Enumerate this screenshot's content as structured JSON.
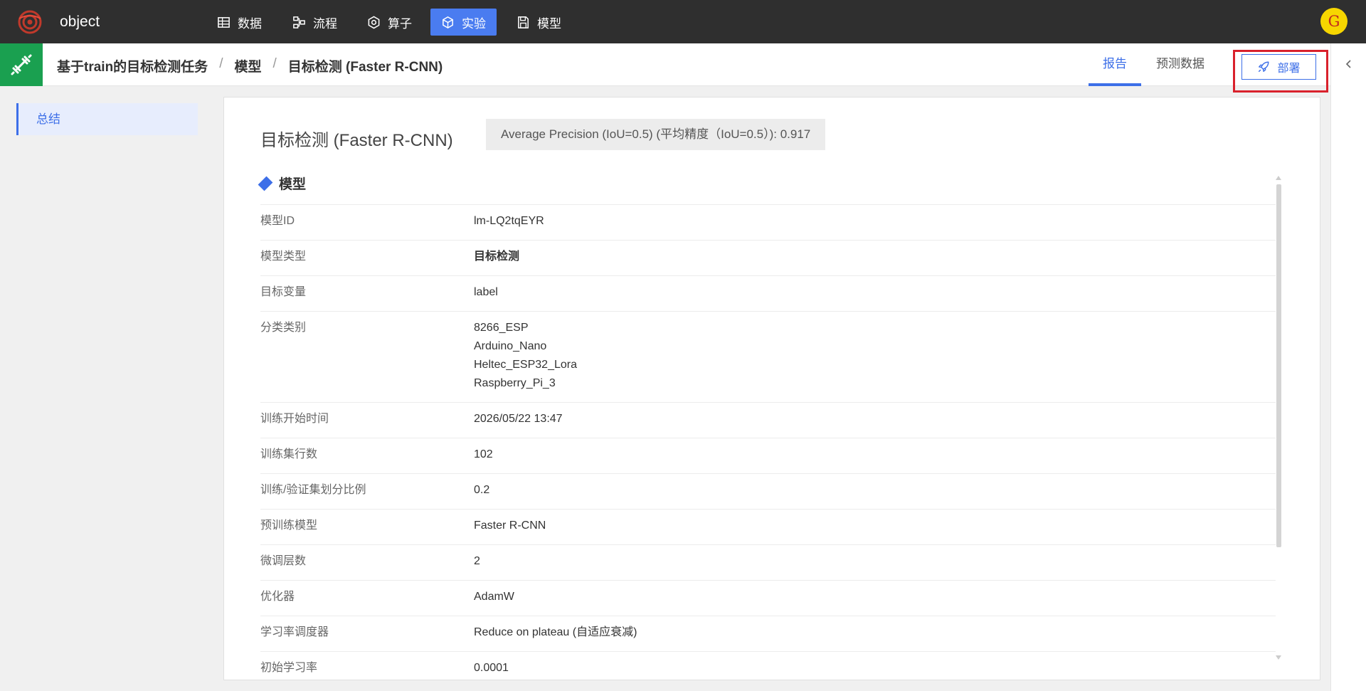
{
  "app": {
    "name": "object",
    "avatar_letter": "G"
  },
  "nav": [
    {
      "label": "数据",
      "icon": "table-icon",
      "active": false
    },
    {
      "label": "流程",
      "icon": "flow-icon",
      "active": false
    },
    {
      "label": "算子",
      "icon": "hexagon-icon",
      "active": false
    },
    {
      "label": "实验",
      "icon": "cube-icon",
      "active": true
    },
    {
      "label": "模型",
      "icon": "save-icon",
      "active": false
    }
  ],
  "breadcrumb": [
    "基于train的目标检测任务",
    "模型",
    "目标检测 (Faster R-CNN)"
  ],
  "breadcrumb_sep": "/",
  "tabs": {
    "report": "报告",
    "prediction": "预测数据"
  },
  "deploy_label": "部署",
  "sidebar": {
    "summary": "总结"
  },
  "card": {
    "title": "目标检测 (Faster R-CNN)",
    "metric": "Average Precision (IoU=0.5) (平均精度（IoU=0.5）): 0.917",
    "section": "模型"
  },
  "rows": [
    {
      "label": "模型ID",
      "value": "lm-LQ2tqEYR"
    },
    {
      "label": "模型类型",
      "value": "目标检测"
    },
    {
      "label": "目标变量",
      "value": "label"
    },
    {
      "label": "分类类别",
      "values": [
        "8266_ESP",
        "Arduino_Nano",
        "Heltec_ESP32_Lora",
        "Raspberry_Pi_3"
      ]
    },
    {
      "label": "训练开始时间",
      "value": "2026/05/22 13:47"
    },
    {
      "label": "训练集行数",
      "value": "102"
    },
    {
      "label": "训练/验证集划分比例",
      "value": "0.2"
    },
    {
      "label": "预训练模型",
      "value": "Faster R-CNN"
    },
    {
      "label": "微调层数",
      "value": "2"
    },
    {
      "label": "优化器",
      "value": "AdamW"
    },
    {
      "label": "学习率调度器",
      "value": "Reduce on plateau (自适应衰减)"
    },
    {
      "label": "初始学习率",
      "value": "0.0001"
    }
  ],
  "colors": {
    "accent": "#3d6fe8",
    "topbar": "#2f2f2f",
    "task_icon": "#1aa050",
    "highlight": "#d9212c"
  }
}
